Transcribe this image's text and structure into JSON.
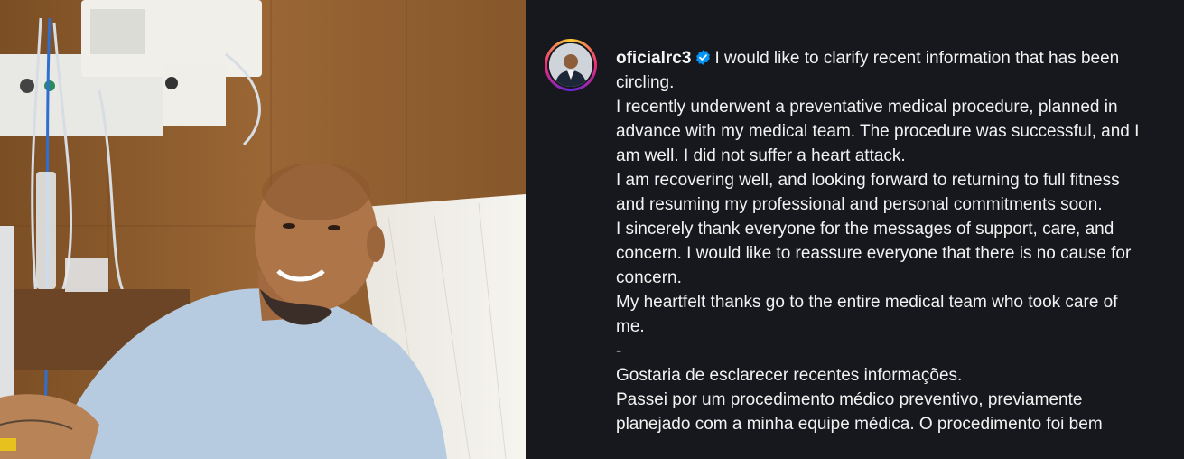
{
  "post": {
    "username": "oficialrc3",
    "caption_first": "I would like to clarify recent information that has been",
    "caption_lines": [
      "circling.",
      "I recently underwent a preventative medical procedure, planned in",
      "advance with my medical team. The procedure was successful, and I",
      "am well. I did not suffer a heart attack.",
      "I am recovering well, and looking forward to returning to full fitness",
      "and resuming my professional and personal commitments soon.",
      "I sincerely thank everyone for the messages of support, care, and",
      "concern. I would like to reassure everyone that there is no cause for",
      "concern.",
      "My heartfelt thanks go to the entire medical team who took care of",
      "me.",
      "-",
      "Gostaria de esclarecer recentes informações.",
      "Passei por um procedimento médico preventivo, previamente",
      "planejado com a minha equipe médica. O procedimento foi bem"
    ]
  },
  "colors": {
    "background": "#16181d",
    "text": "#f2f2f2",
    "verified": "#0095f6"
  },
  "icons": {
    "verified": "verified-badge-icon"
  }
}
